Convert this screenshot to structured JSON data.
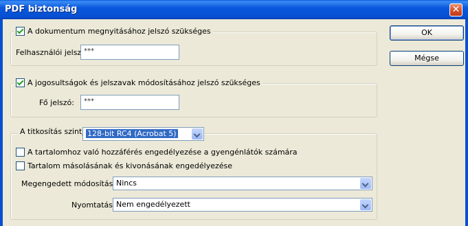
{
  "window": {
    "title": "PDF biztonság",
    "close_glyph": "✕"
  },
  "open_group": {
    "checkbox_label": "A dokumentum megnyitásához jelszó szükséges",
    "checked": true,
    "user_password_label": "Felhasználói jelszó:",
    "user_password_value": "***"
  },
  "perm_group": {
    "checkbox_label": "A jogosultságok és jelszavak módosításához jelszó szükséges",
    "checked": true,
    "master_password_label": "Fő jelszó:",
    "master_password_value": "***"
  },
  "encryption_group": {
    "level_label": "A titkosítás szintje:",
    "level_value": "128-bit RC4 (Acrobat 5)",
    "access_label": "A tartalomhoz való hozzáférés engedélyezése a gyengénlátók számára",
    "access_checked": false,
    "copy_label": "Tartalom másolásának és kivonásának engedélyezése",
    "copy_checked": false,
    "changes_label": "Megengedett módosítások:",
    "changes_value": "Nincs",
    "print_label": "Nyomtatás:",
    "print_value": "Nem engedélyezett"
  },
  "buttons": {
    "ok": "OK",
    "cancel": "Mégse"
  }
}
